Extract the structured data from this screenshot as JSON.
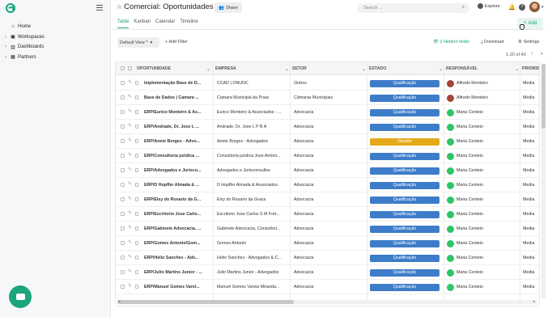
{
  "sidebar": {
    "items": [
      {
        "label": "Home",
        "icon": "home-icon",
        "glyph": "⌂",
        "has_chevron": false
      },
      {
        "label": "Workspaces",
        "icon": "workspaces-icon",
        "glyph": "▣",
        "has_chevron": true
      },
      {
        "label": "Dashboards",
        "icon": "dashboards-icon",
        "glyph": "▥",
        "has_chevron": true
      },
      {
        "label": "Partners",
        "icon": "partners-icon",
        "glyph": "▦",
        "has_chevron": true
      }
    ]
  },
  "header": {
    "title": "Comercial: Oportunidades",
    "share_label": "Share",
    "search_placeholder": "Search ...",
    "explore_label": "Explore"
  },
  "tabs": [
    {
      "label": "Table",
      "active": true
    },
    {
      "label": "Kanban",
      "active": false
    },
    {
      "label": "Calendar",
      "active": false
    },
    {
      "label": "Timeline",
      "active": false
    }
  ],
  "toolbar": {
    "add_label": "Add",
    "view_label": "Default View *",
    "add_filter_label": "Add Filter",
    "hidden_fields_label": "2 Hidden fields",
    "download_label": "Download",
    "settings_label": "Settings",
    "pagination": "1-20 of 40"
  },
  "table": {
    "columns": [
      "OPORTUNIDADE",
      "EMPRESA",
      "SETOR",
      "ESTADO",
      "RESPONSÁVEL",
      "PRIORID"
    ],
    "rows": [
      {
        "oportunidade": "Implementação Base de D...",
        "empresa": "CCAD | ONUDC",
        "setor": "Outros",
        "estado": "Qualificação",
        "responsavel": "Alfredo Monteiro",
        "prioridade": "Media"
      },
      {
        "oportunidade": "Base de Dados | Camara ...",
        "empresa": "Camara Municipal da Praia",
        "setor": "Câmaras Municipais",
        "estado": "Qualificação",
        "responsavel": "Alfredo Monteiro",
        "prioridade": "Media"
      },
      {
        "oportunidade": "ERP/Eurico Monteiro & As...",
        "empresa": "Eurico Monteiro & Associados - ...",
        "setor": "Advocacia",
        "estado": "Qualificação",
        "responsavel": "Maria Centeio",
        "prioridade": "Media"
      },
      {
        "oportunidade": "ERP/Andrade, Dr. Jose L ...",
        "empresa": "Andrade, Dr. Jose L P B A",
        "setor": "Advocacia",
        "estado": "Qualificação",
        "responsavel": "Maria Centeio",
        "prioridade": "Media"
      },
      {
        "oportunidade": "ERP/Anete Borges - Advo...",
        "empresa": "Anete Borges - Advogados",
        "setor": "Advocacia",
        "estado": "Desiste",
        "responsavel": "Maria Centeio",
        "prioridade": "Media"
      },
      {
        "oportunidade": "ERP/Consultoria juridica ...",
        "empresa": "Consultoria juridica Jose Antoni...",
        "setor": "Advocacia",
        "estado": "Qualificação",
        "responsavel": "Maria Centeio",
        "prioridade": "Media"
      },
      {
        "oportunidade": "ERP/Advogados e Jurisco...",
        "empresa": "Advogados e Jurisconsultos",
        "setor": "Advocacia",
        "estado": "Qualificação",
        "responsavel": "Maria Centeio",
        "prioridade": "Media"
      },
      {
        "oportunidade": "ERP/D Hopffer Almada & ...",
        "empresa": "D Hopffer Almada & Associados",
        "setor": "Advocacia",
        "estado": "Qualificação",
        "responsavel": "Maria Centeio",
        "prioridade": "Media"
      },
      {
        "oportunidade": "ERP/Elsy do Rosario da G...",
        "empresa": "Elsy do Rosario da Graca",
        "setor": "Advocacia",
        "estado": "Qualificação",
        "responsavel": "Maria Centeio",
        "prioridade": "Media"
      },
      {
        "oportunidade": "ERP/Escritorio Jose Carlo...",
        "empresa": "Escritorio Jose Carlos S M Fort...",
        "setor": "Advocacia",
        "estado": "Qualificação",
        "responsavel": "Maria Centeio",
        "prioridade": "Media"
      },
      {
        "oportunidade": "ERP/Gabinete Advocacia, ...",
        "empresa": "Gabinete Advocacia, Consultori...",
        "setor": "Advocacia",
        "estado": "Qualificação",
        "responsavel": "Maria Centeio",
        "prioridade": "Media"
      },
      {
        "oportunidade": "ERP/Gomes Antonio/Gom...",
        "empresa": "Gomes Antonio",
        "setor": "Advocacia",
        "estado": "Qualificação",
        "responsavel": "Maria Centeio",
        "prioridade": "Media"
      },
      {
        "oportunidade": "ERP/Helio Sanches - Adv...",
        "empresa": "Helio Sanches - Advogados & C...",
        "setor": "Advocacia",
        "estado": "Qualificação",
        "responsavel": "Maria Centeio",
        "prioridade": "Media"
      },
      {
        "oportunidade": "ERP/Julio Martins Junior - ...",
        "empresa": "Julio Martins Junior - Advogados",
        "setor": "Advocacia",
        "estado": "Qualificação",
        "responsavel": "Maria Centeio",
        "prioridade": "Media"
      },
      {
        "oportunidade": "ERP/Manuel Gomes Varel...",
        "empresa": "Manuel Gomes Vareia Miranda...",
        "setor": "Advocacia",
        "estado": "Qualificação",
        "responsavel": "Maria Centeio",
        "prioridade": "Media"
      }
    ]
  },
  "colors": {
    "accent": "#1aa57a",
    "qualificacao": "#3d7cc9",
    "desiste": "#e5a91a",
    "avatar_alfredo": "#a3453a",
    "avatar_maria": "#2fc468"
  }
}
